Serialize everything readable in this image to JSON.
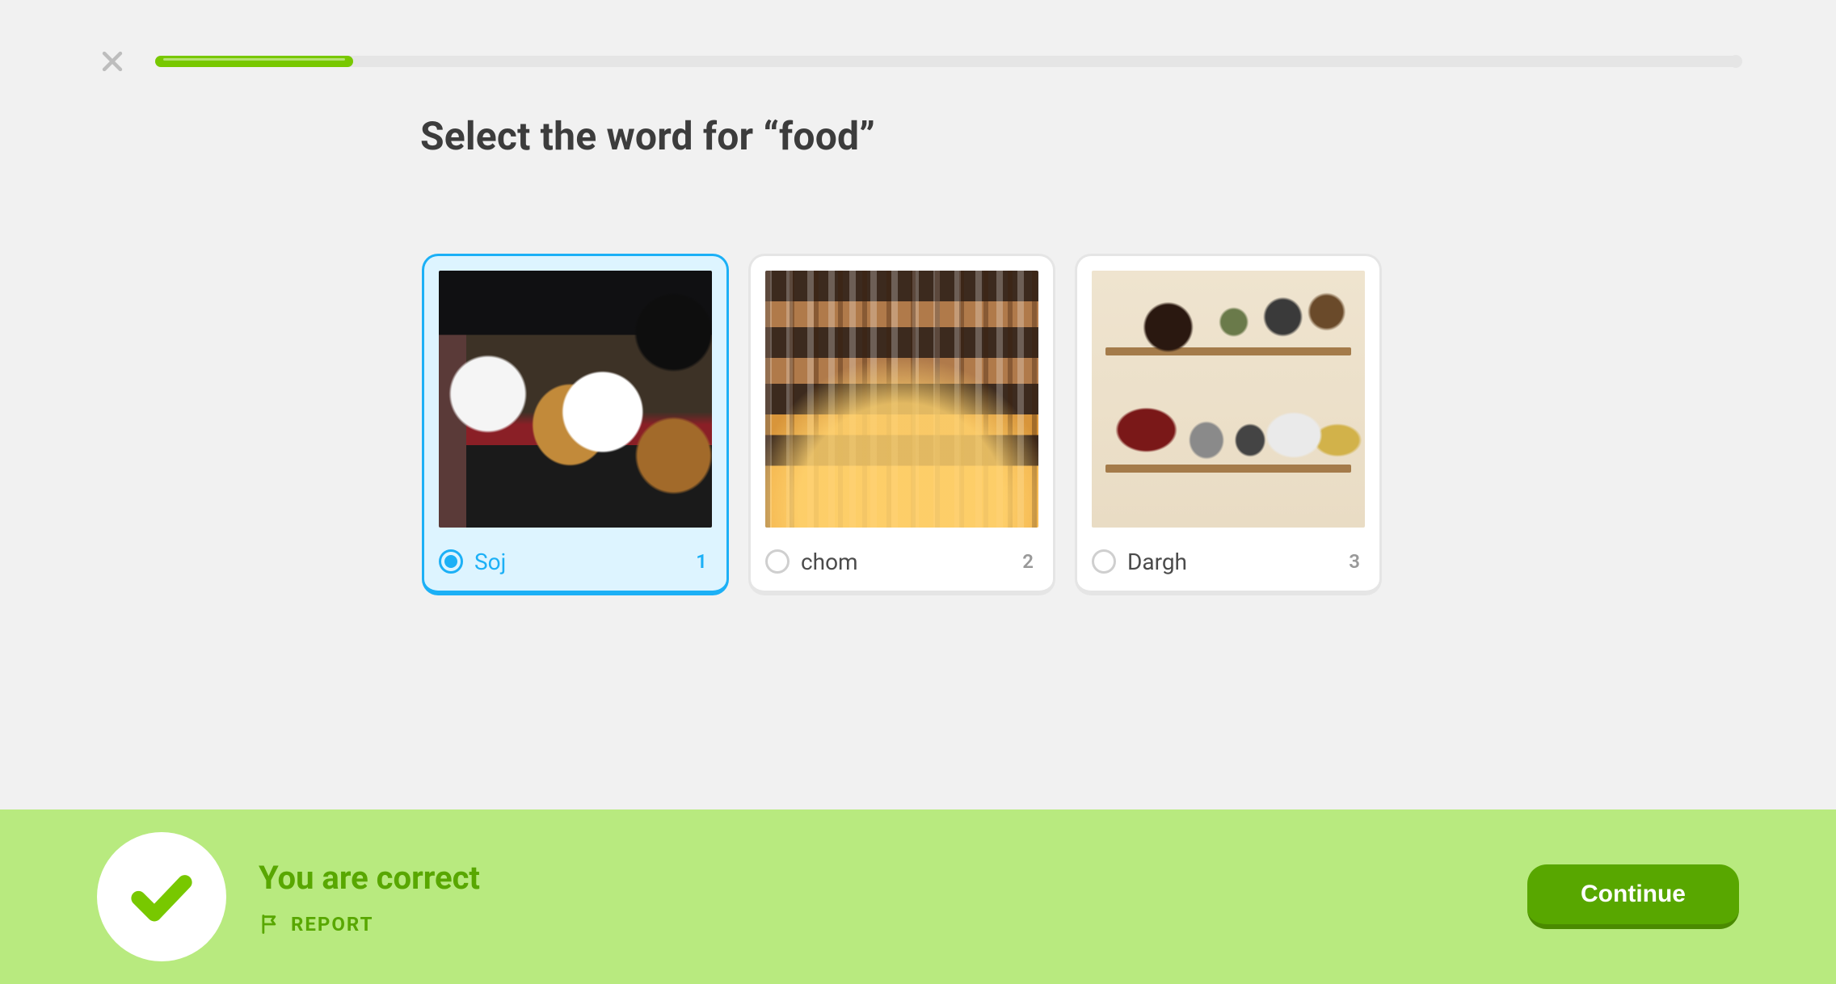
{
  "progress": {
    "percent": 12.5
  },
  "prompt": "Select the word for “food”",
  "cards": [
    {
      "label": "Soj",
      "num": "1",
      "selected": true,
      "image_desc": "Japanese tonkatsu set meal on a tray"
    },
    {
      "label": "chom",
      "num": "2",
      "selected": false,
      "image_desc": "Shelves of liquor bottles at a bar"
    },
    {
      "label": "Dargh",
      "num": "3",
      "selected": false,
      "image_desc": "Kitchen shelf with pots, jars and teapot"
    }
  ],
  "banner": {
    "title": "You are correct",
    "report_label": "REPORT",
    "continue_label": "Continue"
  }
}
